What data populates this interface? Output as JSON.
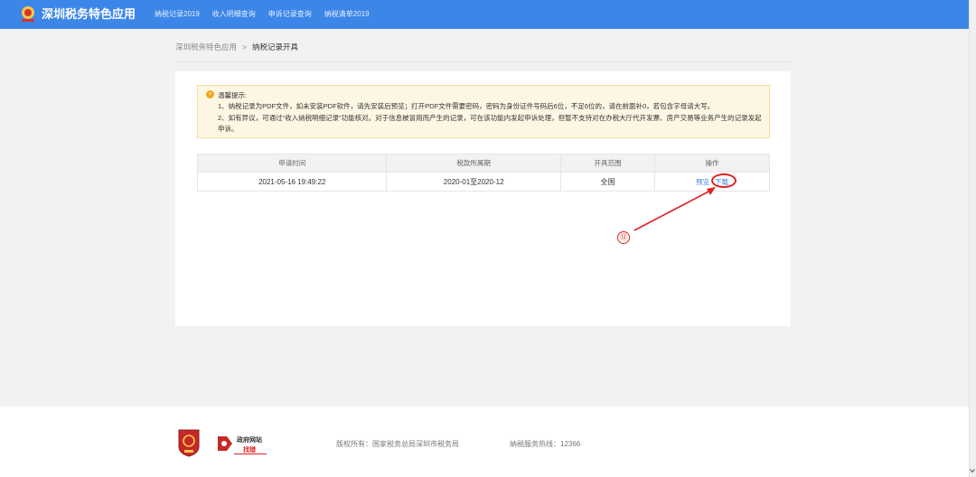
{
  "header": {
    "title": "深圳税务特色应用",
    "nav": [
      "纳税记录2019",
      "收入明细查询",
      "申诉记录查询",
      "纳税清单2019"
    ],
    "brand_color": "#3c86e8"
  },
  "breadcrumb": {
    "parent": "深圳税务特色应用",
    "separator": ">",
    "current": "纳税记录开具"
  },
  "notice": {
    "icon": "info-icon",
    "title": "温馨提示:",
    "line1": "1、纳税记录为PDF文件，如未安装PDF软件，请先安装后预览；打开PDF文件需要密码，密码为身份证件号码后6位，不足6位的，请在前面补0，若包含字母请大写。",
    "line2": "2、如有异议，可通过“收入纳税明细记录”功能核对。对于信息被冒用而产生的记录，可在该功能内发起申诉处理，但暂不支持对在办税大厅代开发票、房产交易等业务产生的记录发起申诉。"
  },
  "table": {
    "headers": [
      "申请时间",
      "税款所属期",
      "开具范围",
      "操作"
    ],
    "rows": [
      {
        "time": "2021-05-16 19:49:22",
        "period": "2020-01至2020-12",
        "scope": "全国",
        "actions": [
          "预览",
          "下载"
        ]
      }
    ]
  },
  "annotation": {
    "marker": "⑫",
    "color": "#e02020"
  },
  "footer": {
    "gov_site_line1": "政府网站",
    "gov_site_line2": "找错",
    "copyright": "版权所有：国家税务总局深圳市税务局",
    "hotline": "纳税服务热线：12366"
  }
}
